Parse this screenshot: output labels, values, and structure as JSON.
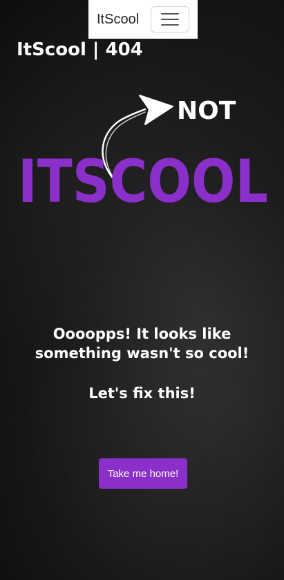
{
  "navbar": {
    "brand": "ItScool",
    "toggle_icon": "hamburger-menu-icon"
  },
  "page": {
    "title": "ItScool | 404"
  },
  "logo": {
    "main_text": "ITSCOOL",
    "overlay_text": "NOT",
    "main_color": "#8a2fc9",
    "overlay_color": "#ffffff",
    "arrow_icon": "curved-arrow-icon"
  },
  "error": {
    "message_line1": "Oooopps! It looks like",
    "message_line2": "something wasn't so cool!",
    "subline": "Let's fix this!"
  },
  "actions": {
    "home_button_label": "Take me home!",
    "home_button_color": "#8a2fc9"
  }
}
